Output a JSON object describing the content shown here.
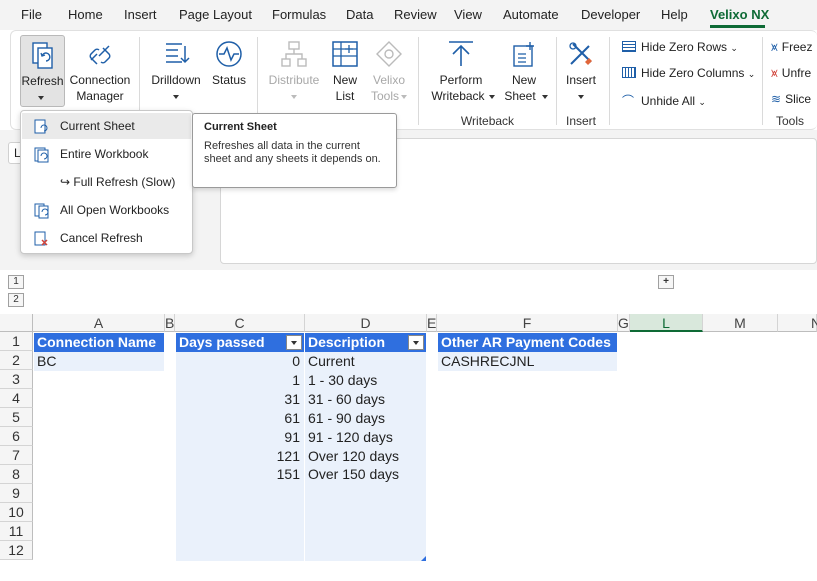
{
  "ribbon_tabs": [
    "File",
    "Home",
    "Insert",
    "Page Layout",
    "Formulas",
    "Data",
    "Review",
    "View",
    "Automate",
    "Developer",
    "Help",
    "Velixo NX"
  ],
  "ribbon": {
    "refresh": "Refresh",
    "connection_manager_1": "Connection",
    "connection_manager_2": "Manager",
    "drilldown": "Drilldown",
    "status": "Status",
    "distribute": "Distribute",
    "new_list_1": "New",
    "new_list_2": "List",
    "velixo_tools_1": "Velixo",
    "velixo_tools_2": "Tools",
    "perform_writeback_1": "Perform",
    "perform_writeback_2": "Writeback",
    "new_sheet_1": "New",
    "new_sheet_2": "Sheet",
    "insert": "Insert",
    "hide_zero_rows": "Hide Zero Rows",
    "hide_zero_columns": "Hide Zero Columns",
    "unhide_all": "Unhide All",
    "freeze": "Freez",
    "unfreeze": "Unfre",
    "slice": "Slice",
    "group_writeback": "Writeback",
    "group_insert": "Insert",
    "group_tools": "Tools"
  },
  "refresh_menu": [
    "Current Sheet",
    "Entire Workbook",
    "↪ Full Refresh (Slow)",
    "All Open Workbooks",
    "Cancel Refresh"
  ],
  "tooltip": {
    "title": "Current Sheet",
    "body": "Refreshes all data in the current sheet and any sheets it depends on."
  },
  "formula_bar_left": "L",
  "outline_levels": [
    "1",
    "2"
  ],
  "outline_expand": "+",
  "columns": [
    "A",
    "B",
    "C",
    "D",
    "E",
    "F",
    "G",
    "L",
    "M",
    "N"
  ],
  "rows": [
    "1",
    "2",
    "3",
    "4",
    "5",
    "6",
    "7",
    "8",
    "9",
    "10",
    "11",
    "12"
  ],
  "table_connection": {
    "header": "Connection Name",
    "rows": [
      "BC"
    ]
  },
  "table_days": {
    "headers": [
      "Days passed",
      "Description"
    ],
    "days": [
      "0",
      "1",
      "31",
      "61",
      "91",
      "121",
      "151"
    ],
    "descriptions": [
      "Current",
      "1 - 30 days",
      "31 - 60 days",
      "61 - 90 days",
      "91 - 120 days",
      "Over 120 days",
      "Over 150 days"
    ]
  },
  "table_ar": {
    "header": "Other AR Payment Codes",
    "rows": [
      "CASHRECJNL"
    ]
  },
  "colors": {
    "accent": "#0e6a35",
    "table_header": "#2f6fdf",
    "table_band": "#eaf1fb"
  }
}
